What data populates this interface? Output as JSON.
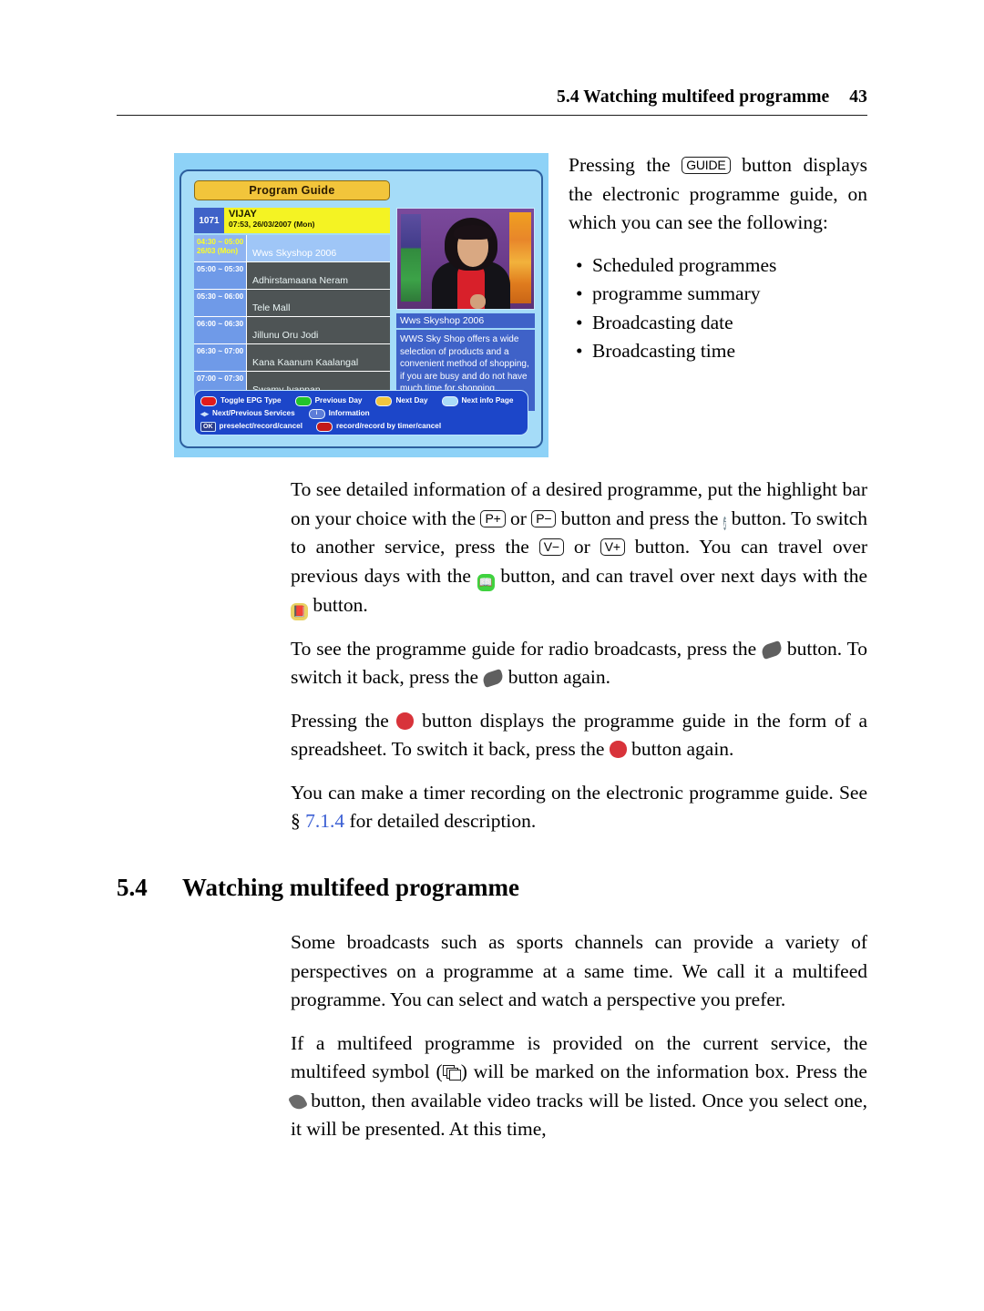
{
  "header": {
    "title": "5.4 Watching multifeed programme",
    "page_number": "43"
  },
  "epg_screenshot": {
    "window_title": "Program Guide",
    "channel": {
      "number": "1071",
      "name": "VIJAY",
      "clock": "07:53, 26/03/2007 (Mon)"
    },
    "rows": [
      {
        "time": "04:30 ~ 05:00",
        "date": "26/03 (Mon)",
        "title": "Wws Skyshop 2006",
        "selected": true
      },
      {
        "time": "05:00 ~ 05:30",
        "date": "",
        "title": "Adhirstamaana Neram",
        "selected": false
      },
      {
        "time": "05:30 ~ 06:00",
        "date": "",
        "title": "Tele Mall",
        "selected": false
      },
      {
        "time": "06:00 ~ 06:30",
        "date": "",
        "title": "Jillunu Oru Jodi",
        "selected": false
      },
      {
        "time": "06:30 ~ 07:00",
        "date": "",
        "title": "Kana Kaanum Kaalangal",
        "selected": false
      },
      {
        "time": "07:00 ~ 07:30",
        "date": "",
        "title": "Swamy Iyappan",
        "selected": false
      }
    ],
    "info_panel": {
      "title": "Wws Skyshop 2006",
      "synopsis": "WWS Sky Shop offers a wide selection of products and a convenient method of shopping, if you are busy and do not have much time for shopping."
    },
    "help_bar": {
      "red_label": "Toggle EPG Type",
      "green_label": "Previous Day",
      "yellow_label": "Next Day",
      "blue_label": "Next info Page",
      "arrows_label": "Next/Previous Services",
      "info_label": "Information",
      "ok_key": "OK",
      "ok_label": "preselect/record/cancel",
      "rec_label": "record/record by timer/cancel"
    }
  },
  "intro": {
    "p1_a": "Pressing the",
    "guide_key": "GUIDE",
    "p1_b": "button displays the electronic programme guide, on which you can see the following:",
    "bullets": [
      "Scheduled programmes",
      "programme summary",
      "Broadcasting date",
      "Broadcasting time"
    ]
  },
  "main": {
    "p2_a": "To see detailed information of a desired programme, put the highlight bar on your choice with the",
    "p_plus_key": "P+",
    "p2_or": "or",
    "p_minus_key": "P−",
    "p2_b": "button and press the",
    "info_icon": "i",
    "p2_c": "button. To switch to another service, press the",
    "v_minus_key": "V−",
    "p2_or2": "or",
    "v_plus_key": "V+",
    "p2_d": "button. You can travel over previous days with the",
    "p2_e": "button, and can travel over next days with the",
    "p2_f": "button.",
    "p3_a": "To see the programme guide for radio broadcasts, press the",
    "p3_b": "button. To switch it back, press the",
    "p3_c": "button again.",
    "p4_a": "Pressing the",
    "p4_b": "button displays the programme guide in the form of a spreadsheet. To switch it back, press the",
    "p4_c": "button again.",
    "p5_a": "You can make a timer recording on the electronic programme guide. See §",
    "p5_ref": "7.1.4",
    "p5_b": "for detailed description."
  },
  "section": {
    "number": "5.4",
    "title": "Watching multifeed programme",
    "p6": "Some broadcasts such as sports channels can provide a variety of perspectives on a programme at a same time. We call it a multifeed programme. You can select and watch a perspective you prefer.",
    "p7_a": "If a multifeed programme is provided on the current service, the multifeed symbol (",
    "p7_b": ") will be marked on the information box.  Press the",
    "p7_c": "button, then available video tracks will be listed. Once you select one, it will be presented. At this time,"
  },
  "colors": {
    "epg_background": "#8ed2f7",
    "epg_title_tab": "#f2c53b",
    "channel_bar": "#f4f323",
    "slot_blue": "#6f9ae8",
    "program_gray": "#4e5455",
    "info_blue": "#3f62c8",
    "help_blue": "#1c46c9",
    "link_blue": "#3b5fd4",
    "red_button": "#d8333a",
    "green_button": "#3fd23f",
    "yellow_button": "#e8d264"
  }
}
